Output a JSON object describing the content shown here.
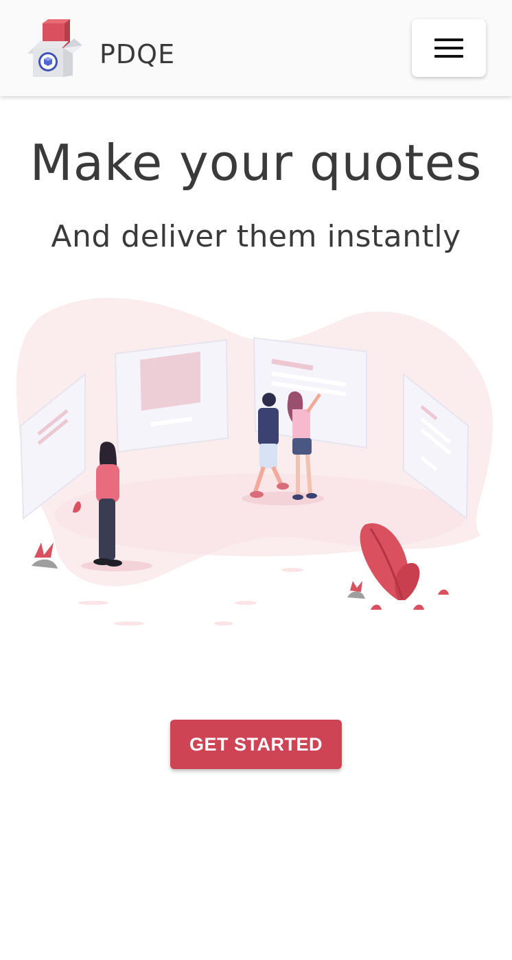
{
  "header": {
    "brand": "PDQE",
    "logo_icon": "box-logo-icon",
    "menu_icon": "hamburger-menu-icon"
  },
  "hero": {
    "title": "Make your quotes",
    "subtitle": "And deliver them instantly"
  },
  "illustration": {
    "name": "gallery-people-illustration"
  },
  "cta": {
    "label": "GET STARTED"
  },
  "colors": {
    "accent": "#cf4455",
    "text": "#3a3a3a",
    "header_bg": "#fafafa",
    "blob": "#fbeced"
  }
}
